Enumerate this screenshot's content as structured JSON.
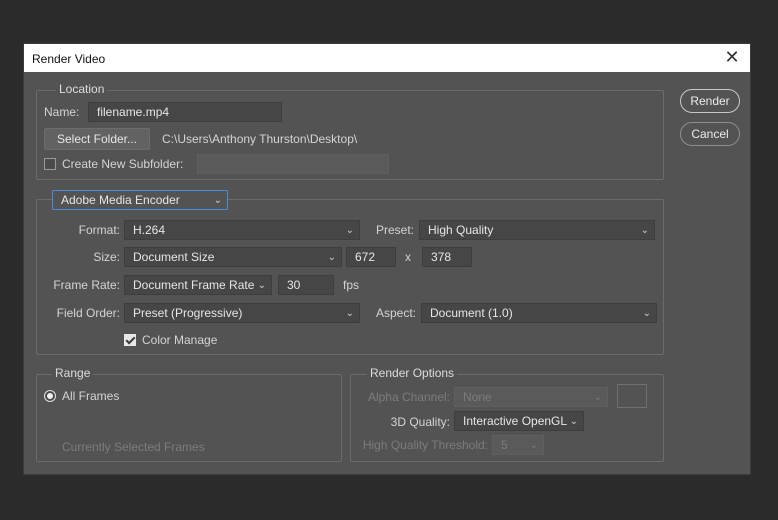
{
  "window": {
    "title": "Render Video",
    "close_glyph": "✕"
  },
  "buttons": {
    "render": "Render",
    "cancel": "Cancel"
  },
  "location": {
    "label": "Location",
    "name_label": "Name:",
    "name_value": "filename.mp4",
    "select_folder": "Select Folder...",
    "folder_path": "C:\\Users\\Anthony Thurston\\Desktop\\",
    "subfolder_label": "Create New Subfolder:",
    "subfolder_value": ""
  },
  "encoder": {
    "selected": "Adobe Media Encoder",
    "format_label": "Format:",
    "format_value": "H.264",
    "preset_label": "Preset:",
    "preset_value": "High Quality",
    "size_label": "Size:",
    "size_value": "Document Size",
    "width": "672",
    "x_sep": "x",
    "height": "378",
    "frame_rate_label": "Frame Rate:",
    "frame_rate_value": "Document Frame Rate",
    "fps_value": "30",
    "fps_unit": "fps",
    "field_order_label": "Field Order:",
    "field_order_value": "Preset (Progressive)",
    "aspect_label": "Aspect:",
    "aspect_value": "Document (1.0)",
    "color_manage_label": "Color Manage",
    "color_manage_checked": true
  },
  "range": {
    "label": "Range",
    "all_frames": "All Frames",
    "current_frames": "Currently Selected Frames"
  },
  "render_options": {
    "label": "Render Options",
    "alpha_label": "Alpha Channel:",
    "alpha_value": "None",
    "quality_label": "3D Quality:",
    "quality_value": "Interactive OpenGL",
    "threshold_label": "High Quality Threshold:",
    "threshold_value": "5"
  },
  "icons": {
    "dropdown": "chevron-down-icon",
    "close": "close-icon"
  },
  "colors": {
    "dialog_bg": "#535353",
    "backdrop": "#2b2b2b",
    "focus": "#4b8ed6"
  }
}
